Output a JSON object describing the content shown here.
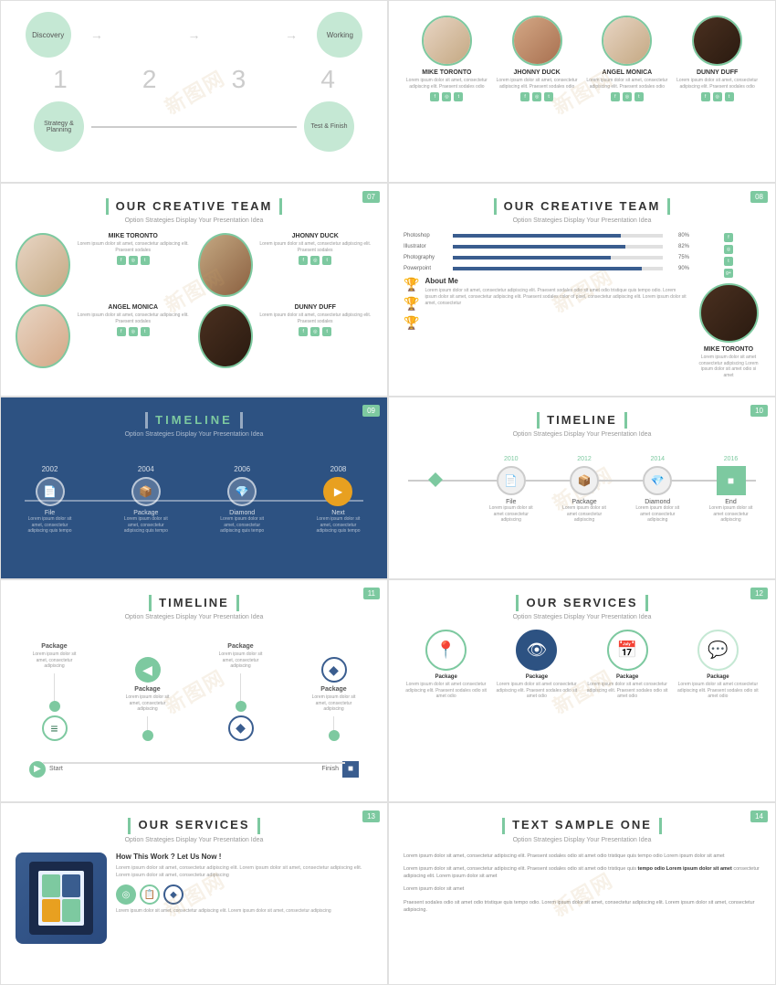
{
  "slides": {
    "slide1": {
      "number": "",
      "steps": [
        "Discovery",
        "Working",
        "Strategy & Planning",
        "Test & Finish"
      ],
      "numbers": [
        "1",
        "2",
        "3",
        "4"
      ]
    },
    "slide2": {
      "number": "",
      "members": [
        {
          "name": "MIKE TORONTO",
          "skin": "light"
        },
        {
          "name": "JHONNY DUCK",
          "skin": "medium"
        },
        {
          "name": "ANGEL MONICA",
          "skin": "light"
        },
        {
          "name": "DUNNY DUFF",
          "skin": "vdark"
        }
      ],
      "text": "Lorem ipsum dolor sit amet, consectetur adipiscing elit. Praesent sodales odio sit amet odio tristique quis tempo odio Lorem ipsum dolor sit amet"
    },
    "slide7": {
      "number": "07",
      "title": "OUR CREATIVE TEAM",
      "subtitle": "Option Strategies Display Your Presentation Idea",
      "members": [
        {
          "name": "MIKE TORONTO",
          "skin": "light"
        },
        {
          "name": "JHONNY DUCK",
          "skin": "medium"
        },
        {
          "name": "ANGEL MONICA",
          "skin": "light"
        },
        {
          "name": "DUNNY DUFF",
          "skin": "vdark"
        }
      ],
      "lorem": "Lorem ipsum dolor sit amet, consectetur adipiscing elit. Praesent sodales odio sit amet odio tristique quis tempo odio"
    },
    "slide8": {
      "number": "08",
      "title": "OUR CREATIVE TEAM",
      "subtitle": "Option Strategies Display Your Presentation Idea",
      "skills": [
        {
          "name": "Photoshop",
          "pct": 80
        },
        {
          "name": "Illustrator",
          "pct": 82
        },
        {
          "name": "Photography",
          "pct": 75
        },
        {
          "name": "Powerpoint",
          "pct": 90
        }
      ],
      "member": {
        "name": "MIKE TORONTO",
        "skin": "vdark"
      },
      "about_title": "About Me",
      "about_text": "Lorem ipsum dolor sit amet, consectetur adipiscing elit. Praesent sodales odio sit amet odio tristique quis tempo odio. Lorem ipsum dolor sit amet, consectetur adipiscing elit. Praesent sodales color of pixel, consectetur adipiscing elit. Lorem ipsum dolor sit amet, consectetur"
    },
    "slide9": {
      "number": "09",
      "title": "TIMELINE",
      "subtitle": "Option Strategies Display Your Presentation Idea",
      "dark": true,
      "items": [
        {
          "year": "2002",
          "label": "File",
          "icon": "📄"
        },
        {
          "year": "2004",
          "label": "Package",
          "icon": "📦"
        },
        {
          "year": "2006",
          "label": "Diamond",
          "icon": "💎"
        },
        {
          "year": "2008",
          "label": "Next",
          "icon": "▶"
        }
      ],
      "lorem": "Lorem ipsum dolor sit amet, consectetur adipiscing elit. Praesent sodales odio sit amet odio tristique quis tempo odio"
    },
    "slide10": {
      "number": "10",
      "title": "TIMELINE",
      "subtitle": "Option Strategies Display Your Presentation Idea",
      "items": [
        {
          "year": "2010",
          "label": "File",
          "icon": "📄"
        },
        {
          "year": "2012",
          "label": "Package",
          "icon": "📦"
        },
        {
          "year": "2014",
          "label": "Diamond",
          "icon": "💎"
        },
        {
          "year": "2016",
          "label": "End",
          "icon": "■"
        }
      ],
      "lorem": "Lorem ipsum dolor sit amet, consectetur adipiscing elit."
    },
    "slide11": {
      "number": "11",
      "title": "TIMELINE",
      "subtitle": "Option Strategies Display Your Presentation Idea",
      "items": [
        {
          "label": "Package",
          "icon": "≡"
        },
        {
          "label": "Package",
          "icon": "◀"
        },
        {
          "label": "Package",
          "icon": "◆"
        },
        {
          "label": "Package",
          "icon": "◆"
        }
      ],
      "start": "Start",
      "finish": "Finish"
    },
    "slide12": {
      "number": "12",
      "title": "OUR SERVICES",
      "subtitle": "Option Strategies Display Your Presentation Idea",
      "services": [
        {
          "label": "Package",
          "icon": "📍"
        },
        {
          "label": "Package",
          "icon": "👁"
        },
        {
          "label": "Package",
          "icon": "📅"
        },
        {
          "label": "Package",
          "icon": "💬"
        }
      ],
      "lorem": "Lorem ipsum dolor sit amet, consectetur adipiscing"
    },
    "slide13": {
      "number": "13",
      "title": "OUR SERVICES",
      "subtitle": "Option Strategies Display Your Presentation Idea",
      "how_title": "How This Work ? Let Us Now !",
      "how_text": "Lorem ipsum dolor sit amet, consectetur adipiscing elit. Lorem ipsum dolor sit amet, consectetur adipiscing elit. Lorem ipsum dolor sit amet, consectetur adipiscing"
    },
    "slide14": {
      "number": "14",
      "title": "TEXT SAMPLE ONE",
      "subtitle": "Option Strategies Display Your Presentation Idea",
      "paragraphs": [
        "Lorem ipsum dolor sit amet, consectetur adipiscing elit. Praesent sodales odio sit amet odio tristique quis tempo odio Lorem ipsum dolor sit amet",
        "Lorem ipsum dolor sit amet, consectetur adipiscing elit. Praesent sodales odio sit amet odio tristique quis tempo odio Lorem ipsum dolor sit amet consectetur adipiscing elit. Lorem ipsum dolor sit amet",
        "Lorem ipsum dolor sit amet",
        "Praesent sodales odio sit amet odio tristique quis tempo odio. Lorem ipsum dolor sit amet, consectetur adipiscing elit. Lorem ipsum dolor sit amet, consectetur adipiscing."
      ]
    }
  },
  "lorem": "Lorem ipsum dolor sit amet, consectetur adipiscing elit. Praesent sodales odio sit amet odio tristique quis tempo odio",
  "lorem_short": "Lorem ipsum dolor sit amet"
}
